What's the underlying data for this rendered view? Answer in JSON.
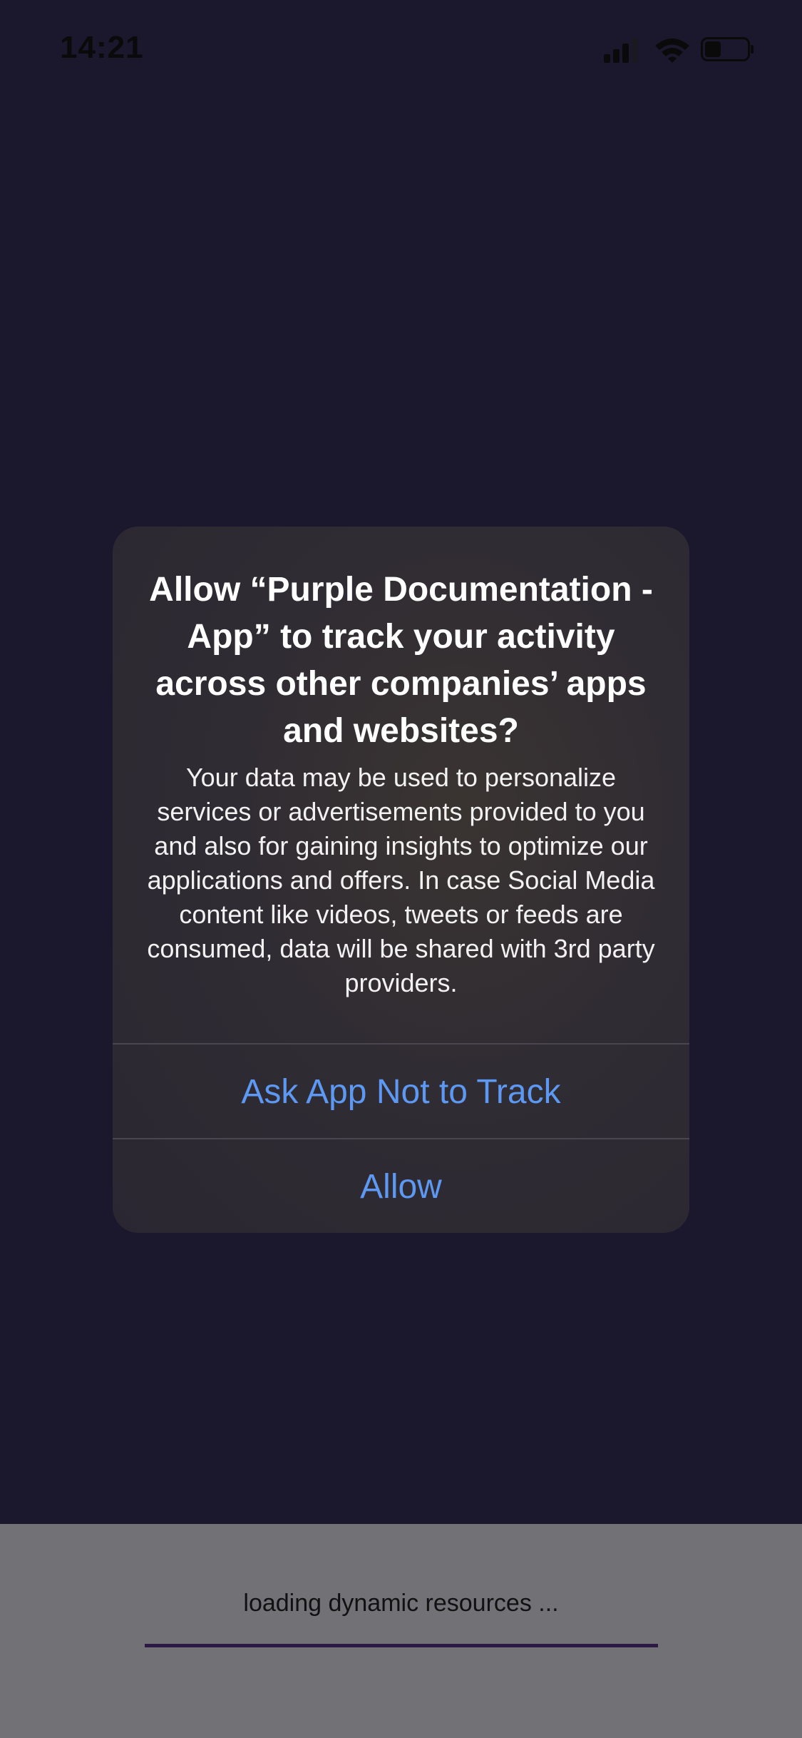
{
  "status_bar": {
    "time": "14:21",
    "icons": [
      "signal-icon",
      "wifi-icon",
      "battery-icon"
    ]
  },
  "dialog": {
    "title": "Allow “Purple Documentation - App” to track your activity across other companies’ apps and websites?",
    "message": "Your data may be used to personalize services or advertisements provided to you and also for gaining insights to optimize our applications and offers. In case Social Media content like videos, tweets or feeds are consumed, data will be shared with 3rd party providers.",
    "buttons": {
      "ask_not_to_track": "Ask App Not to Track",
      "allow": "Allow"
    }
  },
  "loading": {
    "text": "loading dynamic resources ...",
    "progress": 1.0
  },
  "colors": {
    "background": "#1b172d",
    "dialog_button": "#5d98f2",
    "loading_panel": "#727176",
    "progress": "#2c1a44"
  }
}
